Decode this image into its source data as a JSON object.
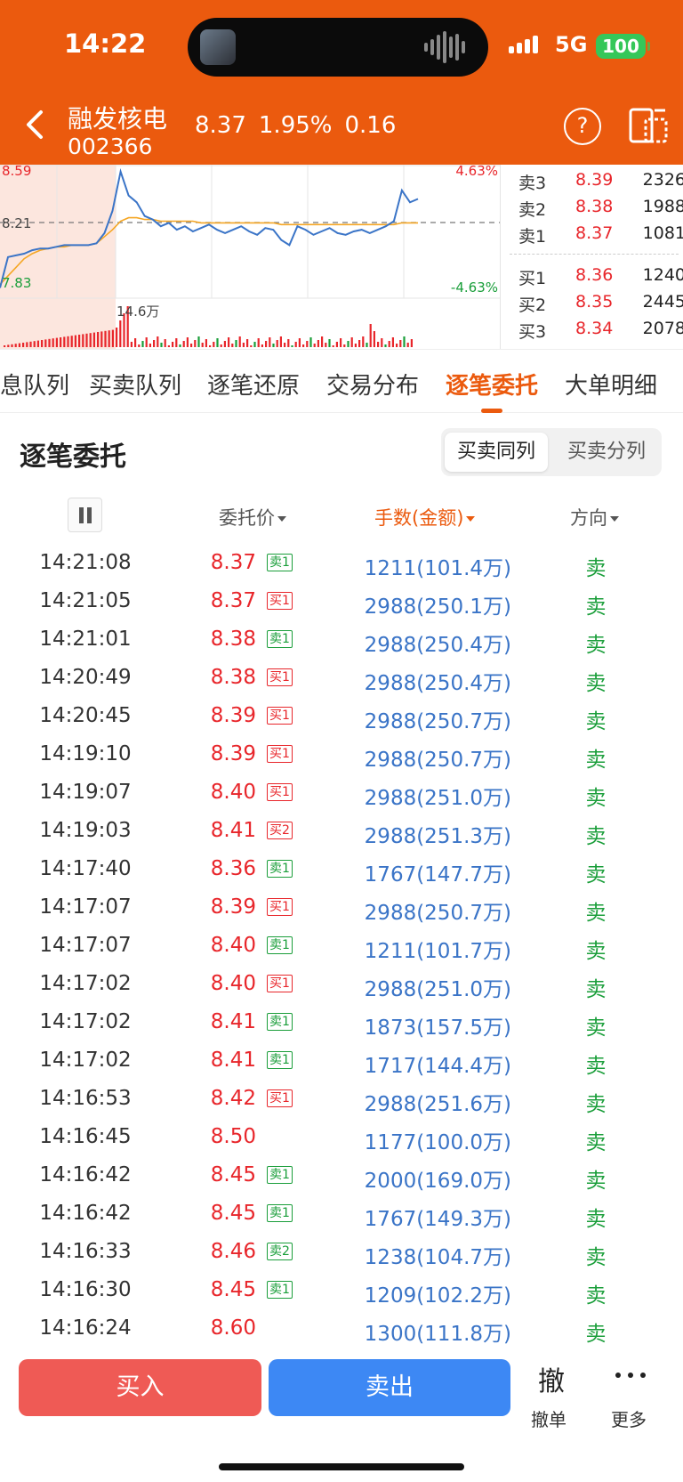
{
  "status": {
    "time": "14:22",
    "network": "5G",
    "battery": "100"
  },
  "stock": {
    "name": "融发核电",
    "code": "002366",
    "price": "8.37",
    "pct": "1.95%",
    "change": "0.16"
  },
  "chart_data": {
    "type": "line",
    "y_labels": {
      "high": "8.59",
      "mid": "8.21",
      "low": "7.83",
      "pct_high": "4.63%",
      "pct_low": "-4.63%"
    },
    "volume_label": "14.6万",
    "ylim": [
      7.83,
      8.59
    ],
    "price_series": [
      7.88,
      8.06,
      8.07,
      8.08,
      8.1,
      8.11,
      8.11,
      8.12,
      8.13,
      8.13,
      8.13,
      8.13,
      8.14,
      8.2,
      8.33,
      8.56,
      8.42,
      8.38,
      8.3,
      8.28,
      8.24,
      8.26,
      8.22,
      8.24,
      8.21,
      8.23,
      8.25,
      8.22,
      8.2,
      8.22,
      8.24,
      8.21,
      8.19,
      8.23,
      8.22,
      8.16,
      8.13,
      8.24,
      8.22,
      8.19,
      8.21,
      8.23,
      8.2,
      8.19,
      8.21,
      8.22,
      8.2,
      8.22,
      8.24,
      8.27,
      8.45,
      8.38,
      8.4
    ],
    "avg_series": [
      7.9,
      7.95,
      8.0,
      8.05,
      8.08,
      8.1,
      8.11,
      8.12,
      8.12,
      8.13,
      8.13,
      8.13,
      8.14,
      8.18,
      8.22,
      8.27,
      8.29,
      8.29,
      8.28,
      8.28,
      8.27,
      8.27,
      8.27,
      8.27,
      8.27,
      8.26,
      8.26,
      8.26,
      8.26,
      8.26,
      8.26,
      8.26,
      8.26,
      8.26,
      8.26,
      8.25,
      8.25,
      8.25,
      8.25,
      8.25,
      8.25,
      8.25,
      8.25,
      8.25,
      8.25,
      8.25,
      8.25,
      8.25,
      8.25,
      8.25,
      8.26,
      8.26,
      8.26
    ]
  },
  "order_book": {
    "asks": [
      {
        "label": "卖3",
        "price": "8.39",
        "vol": "2326"
      },
      {
        "label": "卖2",
        "price": "8.38",
        "vol": "1988"
      },
      {
        "label": "卖1",
        "price": "8.37",
        "vol": "1081"
      }
    ],
    "bids": [
      {
        "label": "买1",
        "price": "8.36",
        "vol": "1240"
      },
      {
        "label": "买2",
        "price": "8.35",
        "vol": "2445"
      },
      {
        "label": "买3",
        "price": "8.34",
        "vol": "2078"
      }
    ],
    "dot_colors": {
      "top": "#3A74C7",
      "bottom": "#EB5A0E",
      "neutral": "#cccccc"
    }
  },
  "tabs": [
    "息队列",
    "买卖队列",
    "逐笔还原",
    "交易分布",
    "逐笔委托",
    "大单明细"
  ],
  "section": {
    "title": "逐笔委托",
    "seg_left": "买卖同列",
    "seg_right": "买卖分列"
  },
  "columns": {
    "price": "委托价",
    "amount": "手数(金额)",
    "direction": "方向"
  },
  "rows": [
    {
      "time": "14:21:08",
      "price": "8.37",
      "tag": "卖1",
      "tag_type": "sell",
      "amount": "1211(101.4万)",
      "dir": "卖"
    },
    {
      "time": "14:21:05",
      "price": "8.37",
      "tag": "买1",
      "tag_type": "buy",
      "amount": "2988(250.1万)",
      "dir": "卖"
    },
    {
      "time": "14:21:01",
      "price": "8.38",
      "tag": "卖1",
      "tag_type": "sell",
      "amount": "2988(250.4万)",
      "dir": "卖"
    },
    {
      "time": "14:20:49",
      "price": "8.38",
      "tag": "买1",
      "tag_type": "buy",
      "amount": "2988(250.4万)",
      "dir": "卖"
    },
    {
      "time": "14:20:45",
      "price": "8.39",
      "tag": "买1",
      "tag_type": "buy",
      "amount": "2988(250.7万)",
      "dir": "卖"
    },
    {
      "time": "14:19:10",
      "price": "8.39",
      "tag": "买1",
      "tag_type": "buy",
      "amount": "2988(250.7万)",
      "dir": "卖"
    },
    {
      "time": "14:19:07",
      "price": "8.40",
      "tag": "买1",
      "tag_type": "buy",
      "amount": "2988(251.0万)",
      "dir": "卖"
    },
    {
      "time": "14:19:03",
      "price": "8.41",
      "tag": "买2",
      "tag_type": "buy",
      "amount": "2988(251.3万)",
      "dir": "卖"
    },
    {
      "time": "14:17:40",
      "price": "8.36",
      "tag": "卖1",
      "tag_type": "sell",
      "amount": "1767(147.7万)",
      "dir": "卖"
    },
    {
      "time": "14:17:07",
      "price": "8.39",
      "tag": "买1",
      "tag_type": "buy",
      "amount": "2988(250.7万)",
      "dir": "卖"
    },
    {
      "time": "14:17:07",
      "price": "8.40",
      "tag": "卖1",
      "tag_type": "sell",
      "amount": "1211(101.7万)",
      "dir": "卖"
    },
    {
      "time": "14:17:02",
      "price": "8.40",
      "tag": "买1",
      "tag_type": "buy",
      "amount": "2988(251.0万)",
      "dir": "卖"
    },
    {
      "time": "14:17:02",
      "price": "8.41",
      "tag": "卖1",
      "tag_type": "sell",
      "amount": "1873(157.5万)",
      "dir": "卖"
    },
    {
      "time": "14:17:02",
      "price": "8.41",
      "tag": "卖1",
      "tag_type": "sell",
      "amount": "1717(144.4万)",
      "dir": "卖"
    },
    {
      "time": "14:16:53",
      "price": "8.42",
      "tag": "买1",
      "tag_type": "buy",
      "amount": "2988(251.6万)",
      "dir": "卖"
    },
    {
      "time": "14:16:45",
      "price": "8.50",
      "tag": "",
      "tag_type": "",
      "amount": "1177(100.0万)",
      "dir": "卖"
    },
    {
      "time": "14:16:42",
      "price": "8.45",
      "tag": "卖1",
      "tag_type": "sell",
      "amount": "2000(169.0万)",
      "dir": "卖"
    },
    {
      "time": "14:16:42",
      "price": "8.45",
      "tag": "卖1",
      "tag_type": "sell",
      "amount": "1767(149.3万)",
      "dir": "卖"
    },
    {
      "time": "14:16:33",
      "price": "8.46",
      "tag": "卖2",
      "tag_type": "sell",
      "amount": "1238(104.7万)",
      "dir": "卖"
    },
    {
      "time": "14:16:30",
      "price": "8.45",
      "tag": "卖1",
      "tag_type": "sell",
      "amount": "1209(102.2万)",
      "dir": "卖"
    },
    {
      "time": "14:16:24",
      "price": "8.60",
      "tag": "",
      "tag_type": "",
      "amount": "1300(111.8万)",
      "dir": "卖"
    }
  ],
  "bottom": {
    "buy": "买入",
    "sell": "卖出",
    "cancel_icon": "撤",
    "cancel": "撤单",
    "more": "更多"
  },
  "colors": {
    "brand": "#EB5A0E",
    "up": "#E8262B",
    "down": "#1a9e3a",
    "amount": "#3A74C7"
  }
}
